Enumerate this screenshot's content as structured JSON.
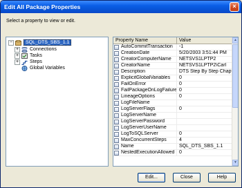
{
  "window": {
    "title": "Edit All Package Properties",
    "close_glyph": "×"
  },
  "instructions": "Select a property to view or edit.",
  "tree": {
    "items": [
      {
        "label": "SQL_DTS_SBS_1.1",
        "expander": "−",
        "icon": "package-icon",
        "selected": true
      },
      {
        "label": "Connections",
        "expander": "+",
        "icon": "connections-icon"
      },
      {
        "label": "Tasks",
        "expander": "+",
        "icon": "tasks-icon"
      },
      {
        "label": "Steps",
        "expander": "+",
        "icon": "steps-icon"
      },
      {
        "label": "Global Variables",
        "expander": "",
        "icon": "global-variables-icon"
      }
    ]
  },
  "grid": {
    "headers": {
      "name": "Property Name",
      "value": "Value"
    },
    "rows": [
      {
        "name": "AutoCommitTransaction",
        "value": "-1"
      },
      {
        "name": "CreationDate",
        "value": "5/20/2003 3:51:44 PM"
      },
      {
        "name": "CreatorComputerName",
        "value": "NETSVS1LPTP2"
      },
      {
        "name": "CreatorName",
        "value": "NETSVS1LPTP2\\Carl"
      },
      {
        "name": "Description",
        "value": "DTS Step By Step Chapter…"
      },
      {
        "name": "ExplicitGlobalVariables",
        "value": "0"
      },
      {
        "name": "FailOnError",
        "value": "0"
      },
      {
        "name": "FailPackageOnLogFailure",
        "value": "0"
      },
      {
        "name": "LineageOptions",
        "value": "0"
      },
      {
        "name": "LogFileName",
        "value": ""
      },
      {
        "name": "LogServerFlags",
        "value": "0"
      },
      {
        "name": "LogServerName",
        "value": ""
      },
      {
        "name": "LogServerPassword",
        "value": ""
      },
      {
        "name": "LogServerUserName",
        "value": ""
      },
      {
        "name": "LogToSQLServer",
        "value": "0"
      },
      {
        "name": "MaxConcurrentSteps",
        "value": "4"
      },
      {
        "name": "Name",
        "value": "SQL_DTS_SBS_1.1"
      },
      {
        "name": "NestedExecutionAllowed",
        "value": "0"
      }
    ]
  },
  "buttons": {
    "edit": "Edit...",
    "close": "Close",
    "help": "Help"
  },
  "scrollbar": {
    "up_glyph": "▲",
    "down_glyph": "▼"
  }
}
